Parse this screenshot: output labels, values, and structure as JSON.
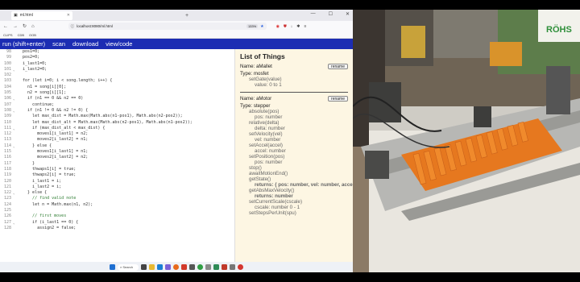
{
  "browser": {
    "tab_title": "ml.html",
    "address": "localhost:8080/ml.html",
    "zoom": "133%",
    "bookmarks": [
      "CLIPS",
      "CDB",
      "OOB"
    ]
  },
  "app_menu": [
    "run (shift+enter)",
    "scan",
    "download",
    "view/code"
  ],
  "code_lines": [
    {
      "n": "98",
      "t": "  pos1=0;"
    },
    {
      "n": "99",
      "t": "  pos2=0;"
    },
    {
      "n": "100",
      "t": "  i_last1=0;"
    },
    {
      "n": "101",
      "t": "  i_last2=0;"
    },
    {
      "n": "102",
      "t": ""
    },
    {
      "n": "103",
      "t": "  for (let i=0; i < song.length; i++) {"
    },
    {
      "n": "104",
      "t": "    n1 = song[i][0];"
    },
    {
      "n": "105",
      "t": "    n2 = song[i][1];"
    },
    {
      "n": "106",
      "t": "    if (n1 == 0 && n2 == 0)"
    },
    {
      "n": "107",
      "t": "      continue;"
    },
    {
      "n": "108",
      "t": "    if (n1 != 0 && n2 != 0) {"
    },
    {
      "n": "109",
      "t": "      let max_dist = Math.max(Math.abs(n1-pos1), Math.abs(n2-pos2));"
    },
    {
      "n": "110",
      "t": "      let max_dist_alt = Math.max(Math.abs(n2-pos1), Math.abs(n1-pos2));"
    },
    {
      "n": "111",
      "t": "      if (max_dist_alt < max_dist) {"
    },
    {
      "n": "112",
      "t": "        moves1[i_last1] = n2;"
    },
    {
      "n": "113",
      "t": "        moves2[i_last2] = n1;"
    },
    {
      "n": "114",
      "t": "      } else {"
    },
    {
      "n": "115",
      "t": "        moves1[i_last1] = n1;"
    },
    {
      "n": "116",
      "t": "        moves2[i_last2] = n2;"
    },
    {
      "n": "117",
      "t": "      }"
    },
    {
      "n": "118",
      "t": "      thwaps1[i] = true;"
    },
    {
      "n": "119",
      "t": "      thwaps2[i] = true;"
    },
    {
      "n": "120",
      "t": "      i_last1 = i;"
    },
    {
      "n": "121",
      "t": "      i_last2 = i;"
    },
    {
      "n": "122",
      "t": "    } else {"
    },
    {
      "n": "123",
      "t": "      // find valid note"
    },
    {
      "n": "124",
      "t": "      let n = Math.max(n1, n2);"
    },
    {
      "n": "125",
      "t": ""
    },
    {
      "n": "126",
      "t": "      // first moves"
    },
    {
      "n": "127",
      "t": "      if (i_last1 == 0) {"
    },
    {
      "n": "128",
      "t": "        assign2 = false;"
    }
  ],
  "panel": {
    "title": "List of Things",
    "rename_label": "rename",
    "things": [
      {
        "name": "Name: aMallet",
        "type": "Type: mosfet",
        "methods": [
          {
            "sig": "setGate(value)",
            "params": [
              "value: 0 to 1"
            ]
          }
        ]
      },
      {
        "name": "Name: aMotor",
        "type": "Type: stepper",
        "methods": [
          {
            "sig": "absolute(pos)",
            "params": [
              "pos: number"
            ]
          },
          {
            "sig": "relative(delta)",
            "params": [
              "delta: number"
            ]
          },
          {
            "sig": "setVelocity(vel)",
            "params": [
              "vel: number"
            ]
          },
          {
            "sig": "setAccel(accel)",
            "params": [
              "accel: number"
            ]
          },
          {
            "sig": "setPosition(pos)",
            "params": [
              "pos: number"
            ]
          },
          {
            "sig": "stop()",
            "params": []
          },
          {
            "sig": "awaitMotionEnd()",
            "params": []
          },
          {
            "sig": "getState()",
            "params": [
              "returns: { pos: number, vel: number, accel: number }"
            ]
          },
          {
            "sig": "getAbsMaxVelocity()",
            "params": [
              "returns: number"
            ]
          },
          {
            "sig": "setCurrentScale(cscale)",
            "params": [
              "cscale: number 0 - 1"
            ]
          },
          {
            "sig": "setStepsPerUnit(spu)",
            "params": []
          }
        ]
      }
    ]
  },
  "taskbar": {
    "search_label": "Search"
  },
  "photo": {
    "sign_text": "RÖHS"
  }
}
